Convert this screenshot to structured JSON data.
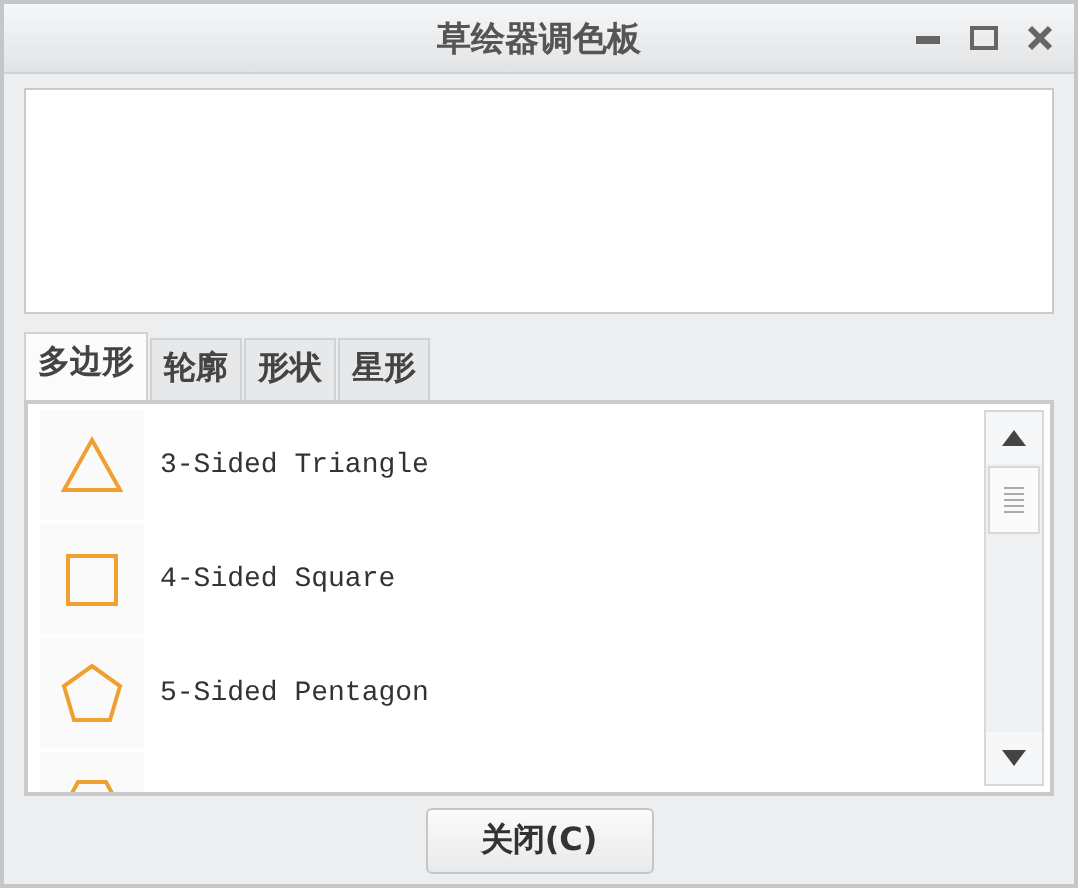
{
  "window": {
    "title": "草绘器调色板"
  },
  "tabs": [
    {
      "label": "多边形",
      "selected": true
    },
    {
      "label": "轮廓",
      "selected": false
    },
    {
      "label": "形状",
      "selected": false
    },
    {
      "label": "星形",
      "selected": false
    }
  ],
  "items": [
    {
      "kind": "triangle",
      "label": "3-Sided Triangle"
    },
    {
      "kind": "square",
      "label": "4-Sided Square"
    },
    {
      "kind": "pentagon",
      "label": "5-Sided Pentagon"
    },
    {
      "kind": "hexagon"
    }
  ],
  "buttons": [
    "关闭(C)"
  ]
}
